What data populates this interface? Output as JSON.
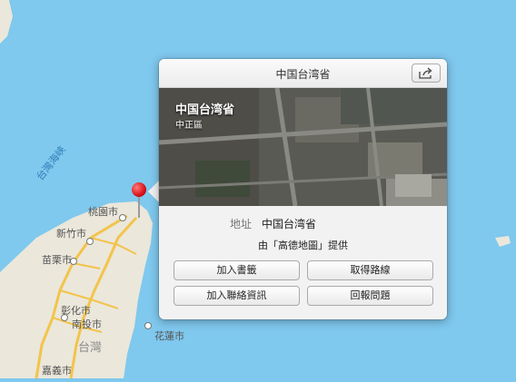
{
  "map": {
    "strait_label": "台灣海峽",
    "place_labels": [
      "桃園市",
      "新竹市",
      "苗栗市",
      "彰化市",
      "南投市",
      "台灣",
      "花蓮市",
      "嘉義市"
    ],
    "colors": {
      "ocean": "#7fc8ee",
      "land": "#ebe7db",
      "road": "#f2c44b"
    }
  },
  "popover": {
    "title": "中国台湾省",
    "share_icon": "share-icon",
    "photo": {
      "title": "中国台湾省",
      "subtitle": "中正區"
    },
    "address_label": "地址",
    "address_value": "中国台湾省",
    "provider": "由「高德地圖」提供",
    "buttons": {
      "add_bookmark": "加入書籤",
      "get_directions": "取得路線",
      "add_contact": "加入聯絡資訊",
      "report_problem": "回報問題"
    }
  }
}
